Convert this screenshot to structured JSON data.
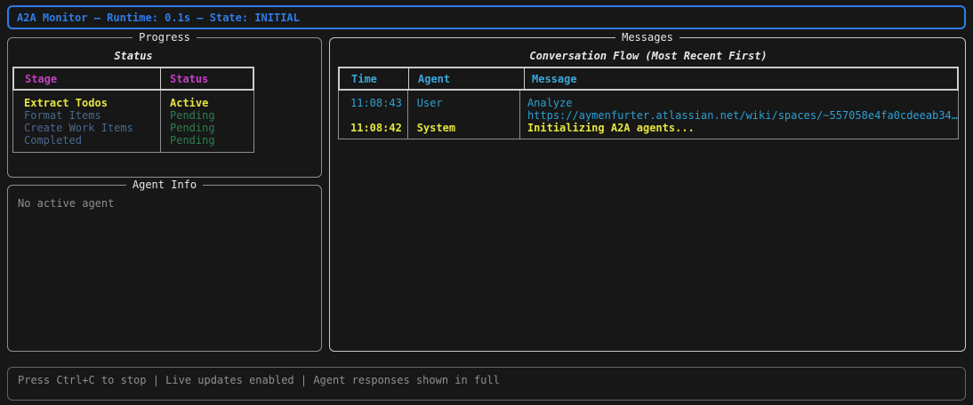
{
  "header": {
    "title": "A2A Monitor — Runtime: 0.1s — State: INITIAL"
  },
  "progress": {
    "panel_title": "Progress",
    "table_title": "Status",
    "columns": {
      "stage": "Stage",
      "status": "Status"
    },
    "rows": [
      {
        "stage": "Extract Todos",
        "status": "Active",
        "state": "active"
      },
      {
        "stage": "Format Items",
        "status": "Pending",
        "state": "pending"
      },
      {
        "stage": "Create Work Items",
        "status": "Pending",
        "state": "pending"
      },
      {
        "stage": "Completed",
        "status": "Pending",
        "state": "pending"
      }
    ]
  },
  "agent_info": {
    "panel_title": "Agent Info",
    "content": "No active agent"
  },
  "messages": {
    "panel_title": "Messages",
    "table_title": "Conversation Flow (Most Recent First)",
    "columns": {
      "time": "Time",
      "agent": "Agent",
      "message": "Message"
    },
    "rows": [
      {
        "time": "11:08:43",
        "agent": "User",
        "lines": [
          "Analyze",
          "https://aymenfurter.atlassian.net/wiki/spaces/~557058e4fa0cdeeab34…"
        ],
        "color": "cyan"
      },
      {
        "time": "11:08:42",
        "agent": "System",
        "lines": [
          "Initializing A2A agents..."
        ],
        "color": "yellow"
      }
    ]
  },
  "footer": {
    "text": "Press Ctrl+C to stop | Live updates enabled | Agent responses shown in full"
  },
  "colors": {
    "accent_blue": "#2e7ce8",
    "header_magenta": "#c43fc4",
    "header_cyan": "#3ba6da",
    "active_yellow": "#e5e43e",
    "pending_stage_blue": "#47698c",
    "pending_status_green": "#2f7d4f",
    "muted_gray": "#8f8f8f",
    "panel_border_gray": "#8f8f8f",
    "messages_border_gray": "#c9c9c9",
    "table_header_border": "#cdcdcd",
    "background": "#171717"
  }
}
